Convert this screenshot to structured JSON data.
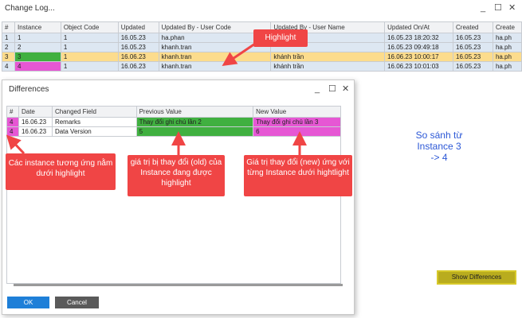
{
  "window": {
    "title": "Change Log...",
    "controls": [
      "_",
      "☐",
      "✕"
    ]
  },
  "main_table": {
    "columns": [
      "#",
      "Instance",
      "Object Code",
      "Updated",
      "Updated By - User Code",
      "Updated By - User Name",
      "Updated On/At",
      "Created",
      "Create"
    ],
    "rows": [
      [
        "1",
        "1",
        "1",
        "16.05.23",
        "ha.phan",
        "",
        "16.05.23 18:20:32",
        "16.05.23",
        "ha.ph"
      ],
      [
        "2",
        "2",
        "1",
        "16.05.23",
        "khanh.tran",
        "",
        "16.05.23 09:49:18",
        "16.05.23",
        "ha.ph"
      ],
      [
        "3",
        "3",
        "1",
        "16.06.23",
        "khanh.tran",
        "khánh trần",
        "16.06.23 10:00:17",
        "16.05.23",
        "ha.ph"
      ],
      [
        "4",
        "4",
        "1",
        "16.06.23",
        "khanh.tran",
        "khánh trần",
        "16.06.23 10:01:03",
        "16.05.23",
        "ha.ph"
      ]
    ]
  },
  "differences": {
    "title": "Differences",
    "controls": [
      "_",
      "☐",
      "✕"
    ],
    "columns": [
      "#",
      "Date",
      "Changed Field",
      "Previous Value",
      "New Value"
    ],
    "rows": [
      [
        "4",
        "16.06.23",
        "Remarks",
        "Thay đổi ghi chú lần 2",
        "Thay đổi ghi chú lần 3"
      ],
      [
        "4",
        "16.06.23",
        "Data Version",
        "5",
        "6"
      ]
    ],
    "ok_label": "OK",
    "cancel_label": "Cancel"
  },
  "show_differences_label": "Show Differences",
  "annotations": {
    "highlight": "Highlight",
    "instances": "Các instance tương ứng nằm dưới highlight",
    "old_value": "giá trị bị thay đổi (old) của Instance đang được highlight",
    "new_value": "Giá trị thay đổi (new) ứng với từng Instance dưới hightlight",
    "compare": "So sánh từ Instance 3 -> 4"
  },
  "colors": {
    "highlight_row": "#fcdc8d",
    "instance_green": "#40b040",
    "instance_magenta": "#e657d4",
    "callout": "#f04545",
    "note_blue": "#2b57d6",
    "ok_button": "#1e7fd8",
    "show_diff_button": "#b9ac1e"
  }
}
